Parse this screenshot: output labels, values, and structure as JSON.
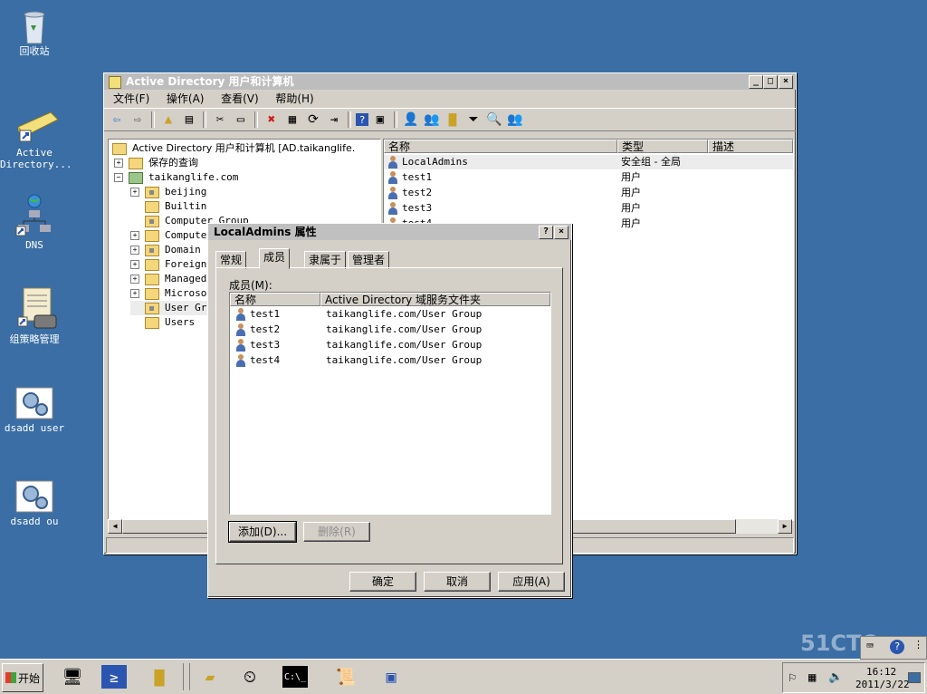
{
  "desktop": {
    "icons": [
      {
        "label": "回收站"
      },
      {
        "label": "Active Directory..."
      },
      {
        "label": "DNS"
      },
      {
        "label": "组策略管理"
      },
      {
        "label": "dsadd user"
      },
      {
        "label": "dsadd ou"
      }
    ]
  },
  "main_window": {
    "title": "Active Directory 用户和计算机",
    "menu": [
      "文件(F)",
      "操作(A)",
      "查看(V)",
      "帮助(H)"
    ],
    "tree": {
      "root": "Active Directory 用户和计算机 [AD.taikanglife.",
      "saved_queries": "保存的查询",
      "domain": "taikanglife.com",
      "children": [
        "beijing",
        "Builtin",
        "Computer Group",
        "Computers",
        "Domain C",
        "ForeignS",
        "Managed",
        "Microsof",
        "User Gro",
        "Users"
      ]
    },
    "list": {
      "columns": [
        "名称",
        "类型",
        "描述"
      ],
      "rows": [
        {
          "name": "LocalAdmins",
          "type": "安全组 - 全局"
        },
        {
          "name": "test1",
          "type": "用户"
        },
        {
          "name": "test2",
          "type": "用户"
        },
        {
          "name": "test3",
          "type": "用户"
        },
        {
          "name": "test4",
          "type": "用户"
        }
      ]
    }
  },
  "dialog": {
    "title": "LocalAdmins 属性",
    "tabs": [
      "常规",
      "成员",
      "隶属于",
      "管理者"
    ],
    "members_label": "成员(M):",
    "columns": [
      "名称",
      "Active Directory 域服务文件夹"
    ],
    "members": [
      {
        "name": "test1",
        "folder": "taikanglife.com/User Group"
      },
      {
        "name": "test2",
        "folder": "taikanglife.com/User Group"
      },
      {
        "name": "test3",
        "folder": "taikanglife.com/User Group"
      },
      {
        "name": "test4",
        "folder": "taikanglife.com/User Group"
      }
    ],
    "add_button": "添加(D)...",
    "remove_button": "删除(R)",
    "ok_button": "确定",
    "cancel_button": "取消",
    "apply_button": "应用(A)"
  },
  "taskbar": {
    "start_label": "开始",
    "time": "16:12",
    "date": "2011/3/22"
  },
  "watermark": "51CTO.com"
}
